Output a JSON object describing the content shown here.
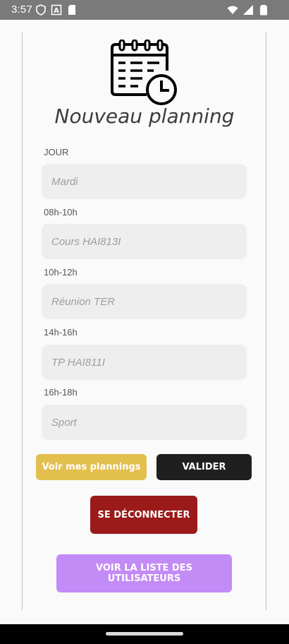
{
  "status_bar": {
    "time": "3:57",
    "left_icons": [
      "shield-icon",
      "font-a-icon",
      "sd-card-icon"
    ],
    "right_icons": [
      "wifi-icon",
      "signal-icon",
      "battery-icon"
    ]
  },
  "header": {
    "icon": "calendar-clock-icon",
    "title": "Nouveau planning"
  },
  "form": {
    "fields": [
      {
        "label": "JOUR",
        "placeholder": "Mardi"
      },
      {
        "label": "08h-10h",
        "placeholder": "Cours HAI813I"
      },
      {
        "label": "10h-12h",
        "placeholder": "Réunion TER"
      },
      {
        "label": "14h-16h",
        "placeholder": "TP HAI811I"
      },
      {
        "label": "16h-18h",
        "placeholder": "Sport"
      }
    ]
  },
  "buttons": {
    "my_plannings": "Voir mes plannings",
    "validate": "VALIDER",
    "logout": "SE DÉCONNECTER",
    "users_list": "VOIR LA LISTE DES UTILISATEURS"
  },
  "colors": {
    "my_plannings": "#e3bf4d",
    "validate": "#1f1f1f",
    "logout": "#9b1a1a",
    "users_list": "#c38bf5"
  }
}
